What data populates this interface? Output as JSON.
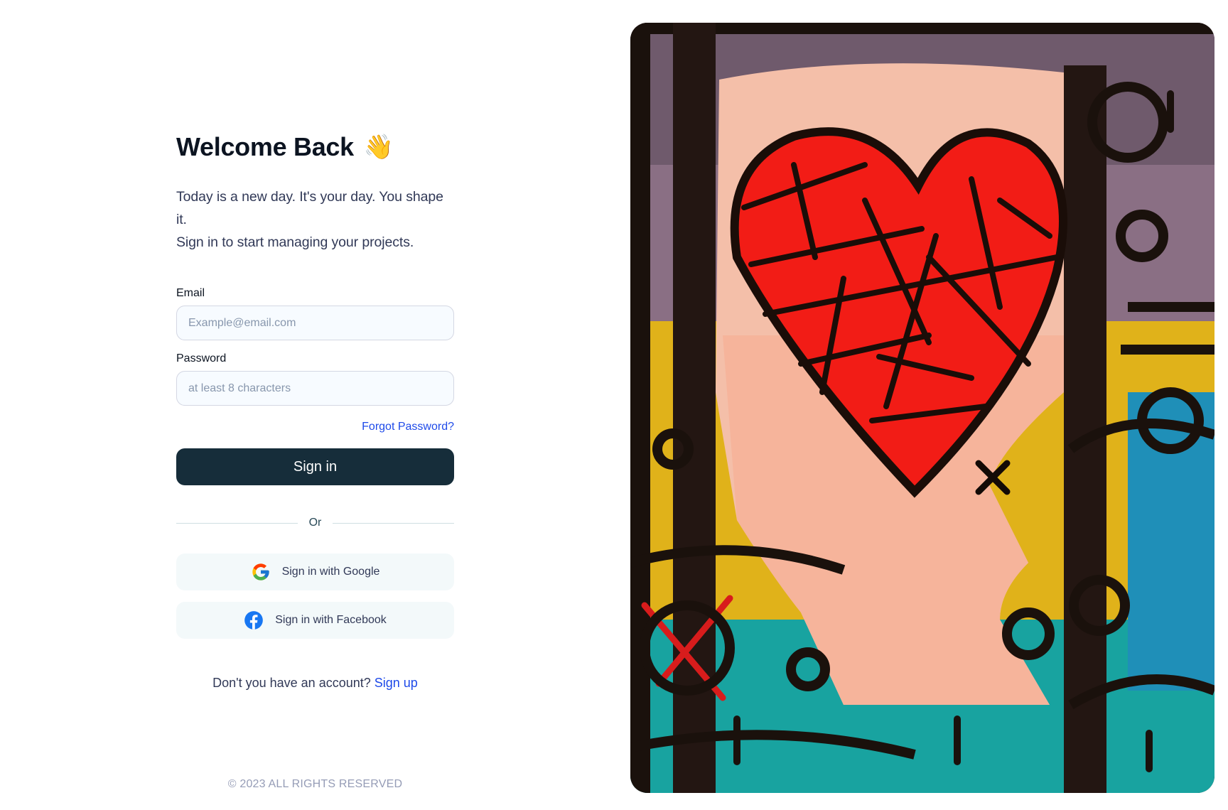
{
  "login": {
    "title": "Welcome Back",
    "title_emoji": "👋",
    "subtitle_line1": "Today is a new day. It's your day. You shape it.",
    "subtitle_line2": "Sign in to start managing your projects.",
    "email": {
      "label": "Email",
      "placeholder": "Example@email.com",
      "value": ""
    },
    "password": {
      "label": "Password",
      "placeholder": "at least 8 characters",
      "value": ""
    },
    "forgot_password": "Forgot Password?",
    "sign_in_label": "Sign in",
    "divider_text": "Or",
    "google_label": "Sign in with Google",
    "facebook_label": "Sign in with Facebook",
    "signup_prompt": "Don't you have an account?",
    "signup_link": "Sign up",
    "footer": "© 2023 ALL RIGHTS RESERVED",
    "icons": {
      "google": "google-logo-icon",
      "facebook": "facebook-logo-icon"
    }
  },
  "colors": {
    "primary_button": "#162d3a",
    "link": "#1e4ae9",
    "input_bg": "#f7fbff",
    "social_bg": "#f3f9fa"
  }
}
